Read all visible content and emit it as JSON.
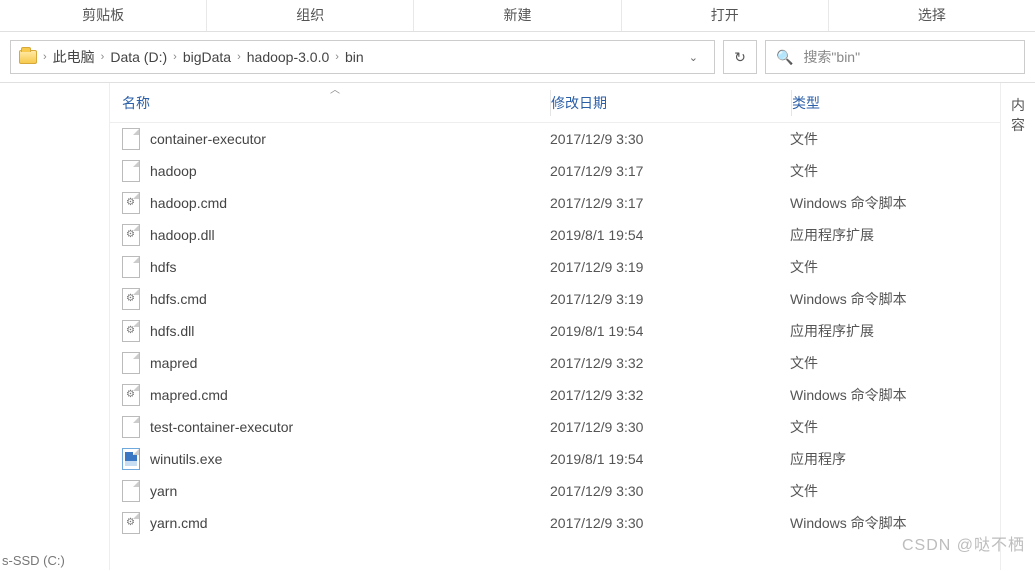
{
  "ribbon": {
    "tabs": [
      "剪贴板",
      "组织",
      "新建",
      "打开",
      "选择"
    ]
  },
  "breadcrumb": {
    "items": [
      "此电脑",
      "Data (D:)",
      "bigData",
      "hadoop-3.0.0",
      "bin"
    ]
  },
  "search": {
    "placeholder": "搜索\"bin\""
  },
  "rightPanel": {
    "label": "内容"
  },
  "leftLabel": "s-SSD (C:)",
  "columns": {
    "name": "名称",
    "date": "修改日期",
    "type": "类型"
  },
  "files": [
    {
      "icon": "file",
      "name": "container-executor",
      "date": "2017/12/9 3:30",
      "type": "文件"
    },
    {
      "icon": "file",
      "name": "hadoop",
      "date": "2017/12/9 3:17",
      "type": "文件"
    },
    {
      "icon": "gear",
      "name": "hadoop.cmd",
      "date": "2017/12/9 3:17",
      "type": "Windows 命令脚本"
    },
    {
      "icon": "gear",
      "name": "hadoop.dll",
      "date": "2019/8/1 19:54",
      "type": "应用程序扩展"
    },
    {
      "icon": "file",
      "name": "hdfs",
      "date": "2017/12/9 3:19",
      "type": "文件"
    },
    {
      "icon": "gear",
      "name": "hdfs.cmd",
      "date": "2017/12/9 3:19",
      "type": "Windows 命令脚本"
    },
    {
      "icon": "gear",
      "name": "hdfs.dll",
      "date": "2019/8/1 19:54",
      "type": "应用程序扩展"
    },
    {
      "icon": "file",
      "name": "mapred",
      "date": "2017/12/9 3:32",
      "type": "文件"
    },
    {
      "icon": "gear",
      "name": "mapred.cmd",
      "date": "2017/12/9 3:32",
      "type": "Windows 命令脚本"
    },
    {
      "icon": "file",
      "name": "test-container-executor",
      "date": "2017/12/9 3:30",
      "type": "文件"
    },
    {
      "icon": "exe",
      "name": "winutils.exe",
      "date": "2019/8/1 19:54",
      "type": "应用程序"
    },
    {
      "icon": "file",
      "name": "yarn",
      "date": "2017/12/9 3:30",
      "type": "文件"
    },
    {
      "icon": "gear",
      "name": "yarn.cmd",
      "date": "2017/12/9 3:30",
      "type": "Windows 命令脚本"
    }
  ],
  "watermark": "CSDN @哒不栖"
}
